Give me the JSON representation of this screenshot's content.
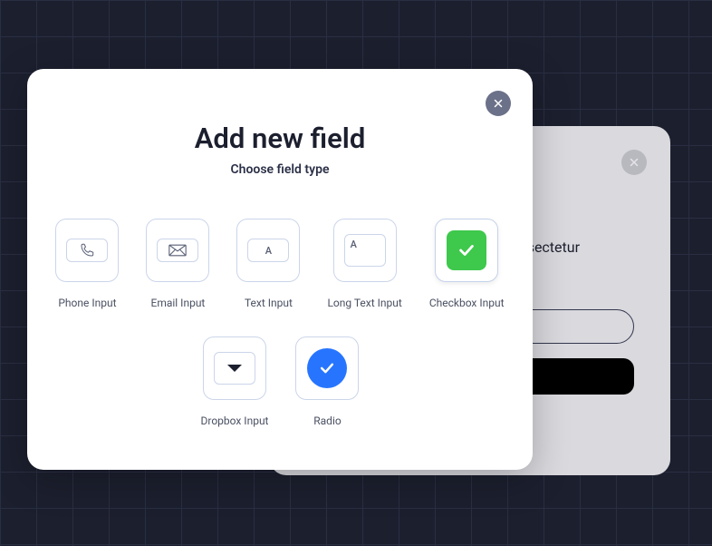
{
  "dialog": {
    "title": "Add new field",
    "subtitle": "Choose field type"
  },
  "fields": {
    "phone": {
      "label": "Phone Input"
    },
    "email": {
      "label": "Email Input"
    },
    "text": {
      "label": "Text Input",
      "placeholder_letter": "A"
    },
    "longtext": {
      "label": "Long Text Input",
      "placeholder_letter": "A"
    },
    "checkbox": {
      "label": "Checkbox Input"
    },
    "dropdown": {
      "label": "Dropbox Input"
    },
    "radio": {
      "label": "Radio"
    }
  },
  "back_panel": {
    "partial_text": "sectetur"
  },
  "colors": {
    "accent_green": "#3ec84c",
    "accent_blue": "#2775ff",
    "text_dark": "#1c1f2e",
    "border": "#cbd5ea"
  }
}
